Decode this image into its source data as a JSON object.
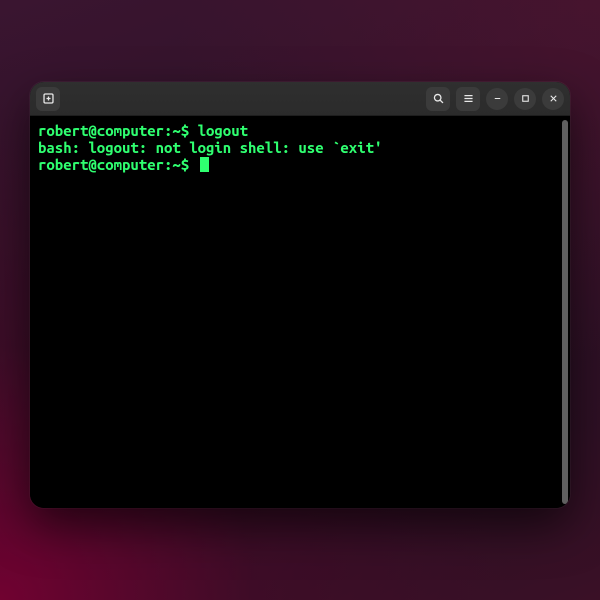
{
  "titlebar": {
    "new_tab_icon": "new-tab-icon",
    "search_icon": "search-icon",
    "menu_icon": "hamburger-menu-icon",
    "minimize_icon": "minimize-icon",
    "maximize_icon": "maximize-icon",
    "close_icon": "close-icon"
  },
  "terminal": {
    "prompt": "robert@computer:~$",
    "lines": [
      {
        "type": "cmd",
        "prompt": "robert@computer:~$",
        "text": "logout"
      },
      {
        "type": "out",
        "text": "bash: logout: not login shell: use `exit'"
      },
      {
        "type": "cmd",
        "prompt": "robert@computer:~$",
        "text": "",
        "cursor": true
      }
    ]
  }
}
